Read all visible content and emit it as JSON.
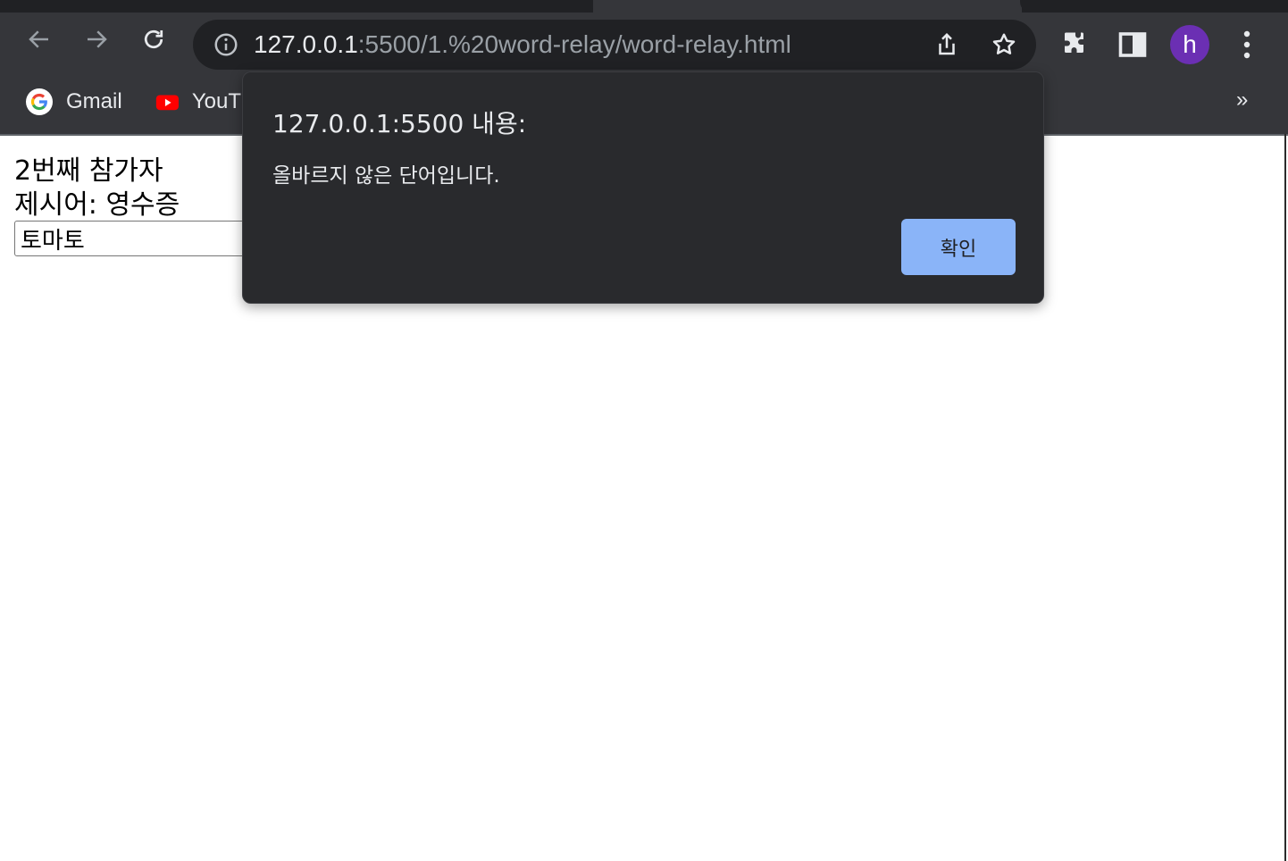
{
  "browser": {
    "url_host": "127.0.0.1",
    "url_path": ":5500/1.%20word-relay/word-relay.html",
    "profile_initial": "h",
    "bookmarks": [
      {
        "label": "Gmail",
        "icon": "google-icon"
      },
      {
        "label": "YouT",
        "icon": "youtube-icon"
      }
    ],
    "bookmarks_overflow": "»"
  },
  "page": {
    "player_line": "2번째 참가자",
    "word_line": "제시어: 영수증",
    "input_value": "토마토"
  },
  "dialog": {
    "title": "127.0.0.1:5500 내용:",
    "message": "올바르지 않은 단어입니다.",
    "ok_label": "확인"
  },
  "colors": {
    "chrome_bg": "#35363a",
    "omnibox_bg": "#202124",
    "dialog_bg": "#292a2d",
    "ok_button": "#8ab4f8",
    "avatar": "#6b2fb3"
  }
}
